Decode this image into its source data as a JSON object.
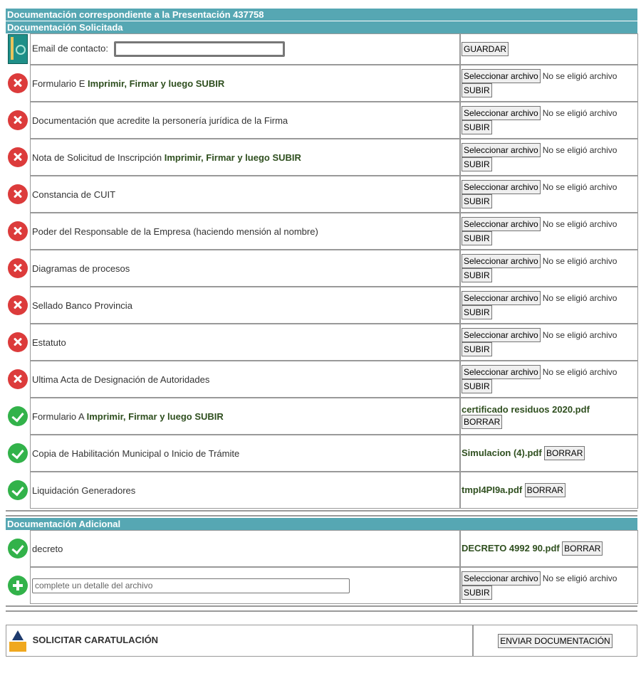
{
  "header": {
    "title": "Documentación correspondiente a la Presentación 437758",
    "section_requested": "Documentación Solicitada",
    "section_additional": "Documentación Adicional"
  },
  "email": {
    "label": "Email de contacto:",
    "save_label": "GUARDAR"
  },
  "common": {
    "select_file_label": "Seleccionar archivo",
    "no_file_text": "No se eligió archivo",
    "upload_label": "SUBIR",
    "delete_label": "BORRAR"
  },
  "requested_docs": [
    {
      "label": "Formulario E",
      "bold": "Imprimir, Firmar y luego SUBIR"
    },
    {
      "label": "Documentación que acredite la personería jurídica de la Firma",
      "bold": ""
    },
    {
      "label": "Nota de Solicitud de Inscripción",
      "bold": "Imprimir, Firmar y luego SUBIR"
    },
    {
      "label": "Constancia de CUIT",
      "bold": ""
    },
    {
      "label": "Poder del Responsable de la Empresa (haciendo mensión al nombre)",
      "bold": ""
    },
    {
      "label": "Diagramas de procesos",
      "bold": ""
    },
    {
      "label": "Sellado Banco Provincia",
      "bold": ""
    },
    {
      "label": "Estatuto",
      "bold": ""
    },
    {
      "label": "Ultima Acta de Designación de Autoridades",
      "bold": ""
    },
    {
      "label": "Formulario A",
      "bold": "Imprimir, Firmar y luego SUBIR",
      "file": "certificado residuos 2020.pdf"
    },
    {
      "label": "Copia de Habilitación Municipal o Inicio de Trámite",
      "bold": "",
      "file": "Simulacion (4).pdf"
    },
    {
      "label": "Liquidación Generadores",
      "bold": "",
      "file": "tmpI4PI9a.pdf"
    }
  ],
  "additional_docs": [
    {
      "label": "decreto",
      "file": "DECRETO 4992 90.pdf"
    }
  ],
  "new_detail": {
    "placeholder": "complete un detalle del archivo"
  },
  "footer": {
    "request_label": "SOLICITAR CARATULACIÓN",
    "send_label": "ENVIAR DOCUMENTACIÓN"
  },
  "colors": {
    "header_bar": "#56a7b3",
    "error": "#dc3b3b",
    "ok": "#32b24a"
  },
  "icons": {
    "pending": "x-circle-icon",
    "done": "check-circle-icon",
    "add": "plus-circle-icon",
    "contact": "contact-book-icon",
    "upload": "upload-arrow-icon"
  }
}
